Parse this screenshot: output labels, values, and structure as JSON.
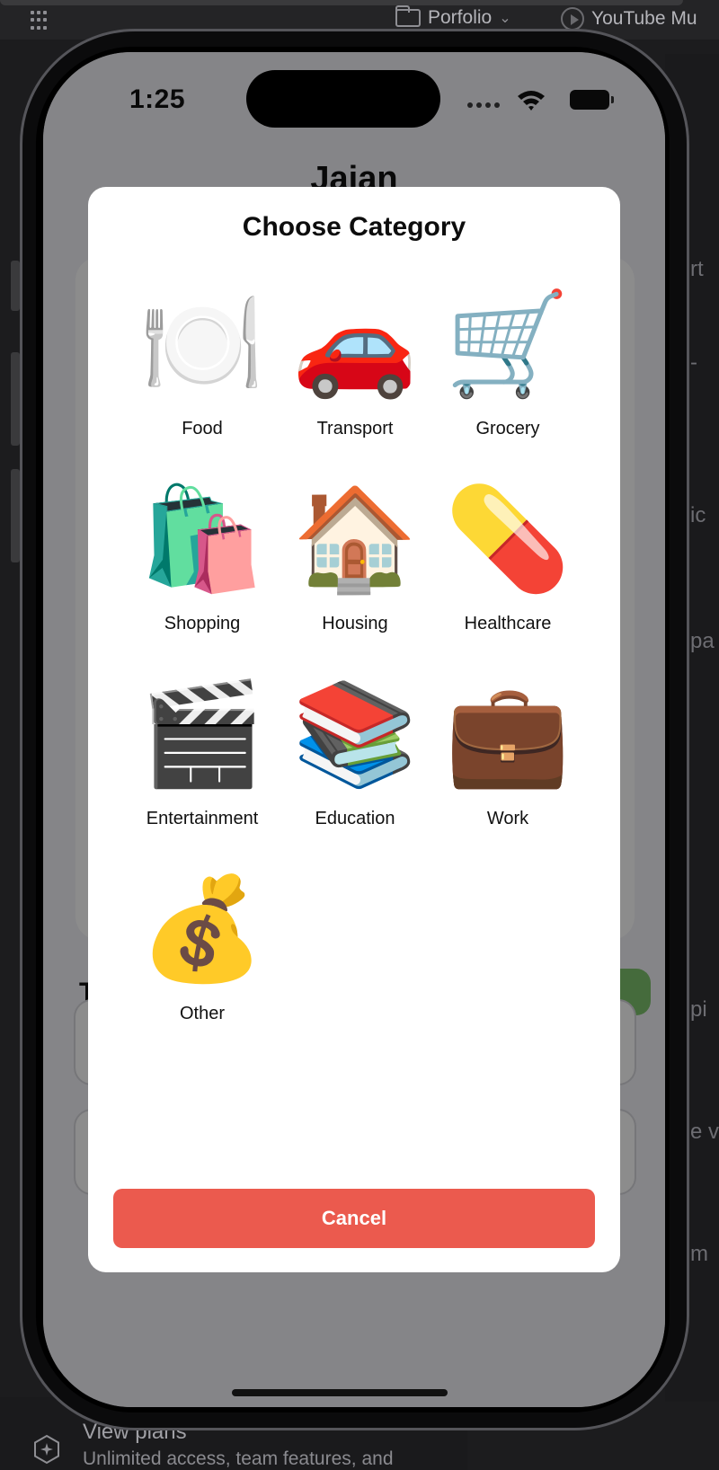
{
  "desktop": {
    "tabs": [
      {
        "label": "Porfolio",
        "icon": "folder-icon"
      },
      {
        "label": "YouTube Mu",
        "icon": "play-icon"
      }
    ],
    "right_fragments": [
      "rt",
      "-",
      "ic",
      "pa",
      "pi",
      "e v",
      "m"
    ],
    "bottom_title": "View plans",
    "bottom_subtitle": "Unlimited access, team features, and"
  },
  "status_bar": {
    "time": "1:25"
  },
  "app": {
    "title": "Jajan",
    "section_initial": "T"
  },
  "modal": {
    "title": "Choose Category",
    "categories": [
      {
        "label": "Food",
        "icon": "food-icon",
        "glyph": "🍽️"
      },
      {
        "label": "Transport",
        "icon": "car-icon",
        "glyph": "🚗"
      },
      {
        "label": "Grocery",
        "icon": "cart-icon",
        "glyph": "🛒"
      },
      {
        "label": "Shopping",
        "icon": "shopping-bags-icon",
        "glyph": "🛍️"
      },
      {
        "label": "Housing",
        "icon": "house-icon",
        "glyph": "🏠"
      },
      {
        "label": "Healthcare",
        "icon": "pill-icon",
        "glyph": "💊"
      },
      {
        "label": "Entertainment",
        "icon": "clapper-board-icon",
        "glyph": "🎬"
      },
      {
        "label": "Education",
        "icon": "books-icon",
        "glyph": "📚"
      },
      {
        "label": "Work",
        "icon": "briefcase-icon",
        "glyph": "💼"
      },
      {
        "label": "Other",
        "icon": "money-bag-icon",
        "glyph": "💰"
      }
    ],
    "cancel_label": "Cancel"
  },
  "colors": {
    "cancel": "#eb5a4e",
    "accent_green": "#7fc46e"
  }
}
